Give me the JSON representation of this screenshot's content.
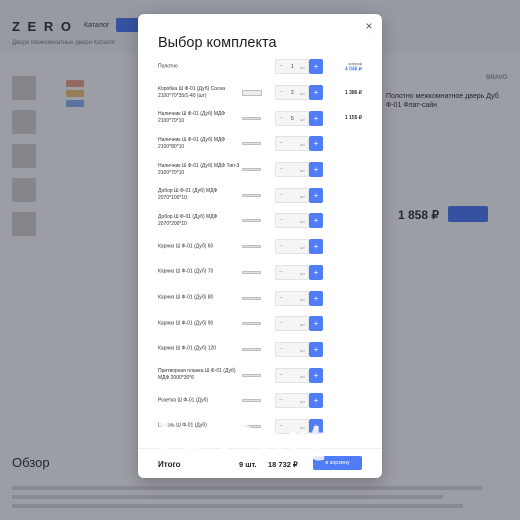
{
  "background": {
    "logo": "Z E R O",
    "nav_item": "Каталог",
    "breadcrumb": "Двери   Межкомнатные двери   Каталог",
    "product_title": "Полотно межкомнатное дверь Дуб Ф-01 Флат-сайн",
    "brand": "BRAVO",
    "price": "1 858 ₽",
    "section_title": "Обзор"
  },
  "modal": {
    "title": "Выбор комплекта",
    "close_label": "×",
    "unit": "шт",
    "minus": "−",
    "plus": "+",
    "items": [
      {
        "name": "Полотно",
        "qty": "1",
        "price_old": "1 999 ₽",
        "price_new": "4 046 ₽",
        "icon": "none"
      },
      {
        "name": "Коробка Ш Ф-01 (Дуб) Сосна 2100*70*35/1-40 (шт)",
        "qty": "2",
        "price": "1 386 ₽",
        "icon": "box"
      },
      {
        "name": "Наличник Ш Ф-01 (Дуб) МДФ 2100*70*10",
        "qty": "5",
        "price": "1 155 ₽",
        "icon": "bar"
      },
      {
        "name": "Наличник Ш Ф-01 (Дуб) МДФ 2100*80*10",
        "qty": "",
        "price": "",
        "icon": "bar"
      },
      {
        "name": "Наличник Ш Ф-01 (Дуб) МДФ Тип-3 2100*70*10",
        "qty": "",
        "price": "",
        "icon": "bar"
      },
      {
        "name": "Добор Ш Ф-01 (Дуб) МДФ 2070*100*10",
        "qty": "",
        "price": "",
        "icon": "bar"
      },
      {
        "name": "Добор Ш Ф-01 (Дуб) МДФ 2070*200*10",
        "qty": "",
        "price": "",
        "icon": "bar"
      },
      {
        "name": "Карниз Ш Ф-01 (Дуб) 60",
        "qty": "",
        "price": "",
        "icon": "bar"
      },
      {
        "name": "Карниз Ш Ф-01 (Дуб) 70",
        "qty": "",
        "price": "",
        "icon": "bar"
      },
      {
        "name": "Карниз Ш Ф-01 (Дуб) 80",
        "qty": "",
        "price": "",
        "icon": "bar"
      },
      {
        "name": "Карниз Ш Ф-01 (Дуб) 90",
        "qty": "",
        "price": "",
        "icon": "bar"
      },
      {
        "name": "Карниз Ш Ф-01 (Дуб) 120",
        "qty": "",
        "price": "",
        "icon": "bar"
      },
      {
        "name": "Притворная планка Ш Ф-01 (Дуб) МДФ 2000*30*6",
        "qty": "",
        "price": "",
        "icon": "bar"
      },
      {
        "name": "Розетка Ш Ф-01 (Дуб)",
        "qty": "",
        "price": "",
        "icon": "bar"
      },
      {
        "name": "Цоколь Ш Ф-01 (Дуб)",
        "qty": "",
        "price": "",
        "icon": "bar"
      }
    ],
    "footer": {
      "label": "Итого",
      "count": "9 шт.",
      "total": "18 732 ₽",
      "button": "в корзину"
    }
  },
  "watermark": "is.Cart",
  "colors": {
    "accent": "#4f7cf7"
  }
}
